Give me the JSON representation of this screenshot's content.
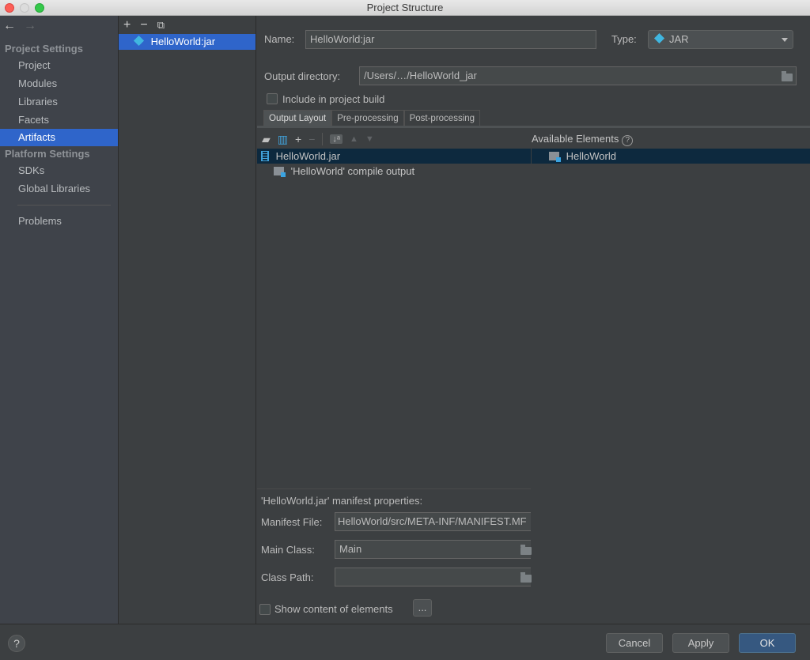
{
  "window": {
    "title": "Project Structure"
  },
  "nav": {
    "sections": [
      {
        "title": "Project Settings"
      },
      {
        "title": "Platform Settings"
      }
    ],
    "project_items": [
      "Project",
      "Modules",
      "Libraries",
      "Facets",
      "Artifacts"
    ],
    "platform_items": [
      "SDKs",
      "Global Libraries"
    ],
    "other_items": [
      "Problems"
    ],
    "selected": "Artifacts"
  },
  "artifacts": {
    "toolbar": {
      "add": "+",
      "remove": "−",
      "copy": "⧉"
    },
    "items": [
      "HelloWorld:jar"
    ]
  },
  "form": {
    "name_label": "Name:",
    "name_value": "HelloWorld:jar",
    "type_label": "Type:",
    "type_value": "JAR",
    "output_dir_label": "Output directory:",
    "output_dir_value": "/Users/…/HelloWorld_jar",
    "include_label": "Include in project build",
    "include_checked": false
  },
  "tabs": [
    "Output Layout",
    "Pre-processing",
    "Post-processing"
  ],
  "active_tab": "Output Layout",
  "layout": {
    "tree": [
      "HelloWorld.jar",
      "'HelloWorld' compile output"
    ],
    "available_header": "Available Elements",
    "available_items": [
      "HelloWorld"
    ]
  },
  "manifest": {
    "title": "'HelloWorld.jar' manifest properties:",
    "manifest_file_label": "Manifest File:",
    "manifest_file_value": "HelloWorld/src/META-INF/MANIFEST.MF",
    "main_class_label": "Main Class:",
    "main_class_value": "Main",
    "class_path_label": "Class Path:",
    "class_path_value": "",
    "show_content_label": "Show content of elements",
    "more_button": "..."
  },
  "footer": {
    "help": "?",
    "cancel": "Cancel",
    "apply": "Apply",
    "ok": "OK"
  },
  "colors": {
    "selection": "#2f65ca",
    "primary_button": "#365880",
    "background": "#3c3f41"
  }
}
